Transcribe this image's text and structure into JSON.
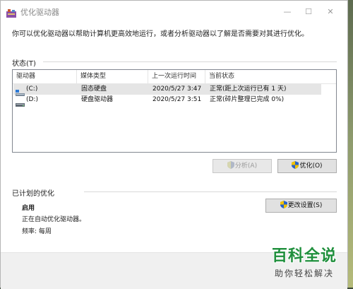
{
  "window": {
    "title": "优化驱动器",
    "controls": {
      "minimize": "—",
      "maximize": "☐",
      "close": "✕"
    }
  },
  "description": "你可以优化驱动器以帮助计算机更高效地运行，或者分析驱动器以了解是否需要对其进行优化。",
  "status": {
    "section_label": "状态(T)",
    "columns": [
      "驱动器",
      "媒体类型",
      "上一次运行时间",
      "当前状态"
    ],
    "rows": [
      {
        "drive": "(C:)",
        "media": "固态硬盘",
        "last_run": "2020/5/27 3:47",
        "state": "正常(距上次运行已有 1 天)"
      },
      {
        "drive": "(D:)",
        "media": "硬盘驱动器",
        "last_run": "2020/5/27 3:51",
        "state": "正常(碎片整理已完成 0%)"
      }
    ],
    "analyze_button": "分析(A)",
    "optimize_button": "优化(O)"
  },
  "scheduled": {
    "section_label": "已计划的优化",
    "state": "启用",
    "detail": "正在自动优化驱动器。",
    "frequency": "频率: 每周",
    "change_button": "更改设置(S)"
  },
  "watermark": {
    "top": "百科全说",
    "bottom": "助你轻松解决"
  },
  "colors": {
    "shield_blue": "#2a62c9",
    "shield_yellow": "#f2c200",
    "watermark_green": "#1f8f3c"
  }
}
